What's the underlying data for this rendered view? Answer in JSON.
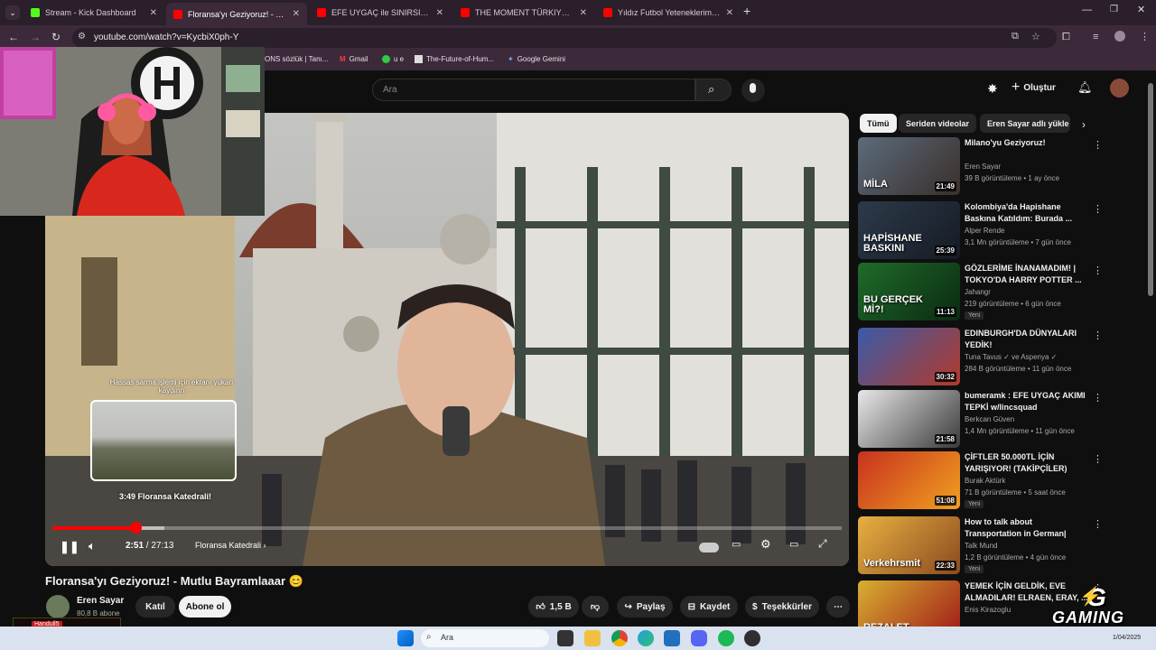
{
  "browser": {
    "tabs": [
      {
        "label": "Stream - Kick Dashboard",
        "active": false,
        "icon_color": "#53fc18"
      },
      {
        "label": "Floransa'yı Geziyoruz! - Mu",
        "active": true,
        "icon_color": "#ff0000"
      },
      {
        "label": "EFE UYGAÇ ile SINIRSIZ YEMEK",
        "active": false,
        "icon_color": "#ff0000"
      },
      {
        "label": "THE MOMENT TÜRKIYE QUALIF",
        "active": false,
        "icon_color": "#ff0000"
      },
      {
        "label": "Yıldız Futbol Yeteneklerimi Puan",
        "active": false,
        "icon_color": "#ff0000"
      }
    ],
    "url": "youtube.com/watch?v=KycbiX0ph-Y",
    "bookmarks": [
      {
        "label": "ONS sözlük | Tanı...",
        "icon": "dictionary-icon"
      },
      {
        "label": "Gmail",
        "icon": "gmail-icon"
      },
      {
        "label": "u e",
        "icon": "green-dot-icon"
      },
      {
        "label": "The-Future-of-Hum...",
        "icon": "page-icon"
      },
      {
        "label": "Google Gemini",
        "icon": "gemini-icon"
      }
    ]
  },
  "youtube": {
    "search_placeholder": "Ara",
    "create_label": "Oluştur",
    "video": {
      "title": "Floransa'yı Geziyoruz! - Mutlu Bayramlaaar 😊",
      "time_current": "2:51",
      "time_total": "27:13",
      "chapter": "Floransa Katedrali",
      "progress_fraction": 0.105,
      "preview_time": "3:49",
      "preview_chapter": "Floransa Katedrali!",
      "scroll_hint": "Hassas sarma işlemi için ekranı yukarı kaydırın"
    },
    "channel": {
      "name": "Eren Sayar",
      "subscribers": "80,8 B abone",
      "join_label": "Katıl",
      "subscribe_label": "Abone ol"
    },
    "actions": {
      "likes": "1,5 B",
      "share": "Paylaş",
      "save": "Kaydet",
      "thanks": "Teşekkürler"
    },
    "chips": [
      "Tümü",
      "Seriden videolar",
      "Eren Sayar adlı yükle"
    ],
    "recommendations": [
      {
        "title": "Milano'yu Geziyoruz!",
        "channel": "Eren Sayar",
        "views": "39 B görüntüleme • 1 ay önce",
        "duration": "21:49",
        "badge": "",
        "thumb_text": "MİLA",
        "colors": [
          "#5b6b7c",
          "#3a2f2a"
        ]
      },
      {
        "title": "Kolombiya'da Hapishane Baskına Katıldım: Burada ...",
        "channel": "Alper Rende",
        "views": "3,1 Mn görüntüleme • 7 gün önce",
        "duration": "25:39",
        "badge": "",
        "thumb_text": "HAPİSHANE BASKINI",
        "colors": [
          "#2d3a4a",
          "#151b24"
        ]
      },
      {
        "title": "GÖZLERİME İNANAMADIM! | TOKYO'DA HARRY POTTER ...",
        "channel": "Jahangr",
        "views": "219 görüntüleme • 6 gün önce",
        "duration": "11:13",
        "badge": "Yeni",
        "thumb_text": "BU GERÇEK Mİ?!",
        "colors": [
          "#1f6b2a",
          "#0b2a12"
        ]
      },
      {
        "title": "EDINBURGH'DA DÜNYALARI YEDİK!",
        "channel": "Tuna Tavus ✓ ve Aspenya ✓",
        "views": "284 B görüntüleme • 11 gün önce",
        "duration": "30:32",
        "badge": "",
        "thumb_text": "",
        "colors": [
          "#3a5aa8",
          "#b23a2a"
        ]
      },
      {
        "title": "bumeramk : EFE UYGAÇ AKIMI TEPKİ w/lincsquad",
        "channel": "Berkcan Güven",
        "views": "1,4 Mn görüntüleme • 11 gün önce",
        "duration": "21:58",
        "badge": "",
        "thumb_text": "",
        "colors": [
          "#e8e8e8",
          "#3a3a3a"
        ]
      },
      {
        "title": "ÇİFTLER 50.000TL İÇİN YARIŞIYOR! (TAKİPÇİLER)",
        "channel": "Burak Aktürk",
        "views": "71 B görüntüleme • 5 saat önce",
        "duration": "51:08",
        "badge": "Yeni",
        "thumb_text": "",
        "colors": [
          "#c8321e",
          "#f0a020"
        ]
      },
      {
        "title": "How to talk about Transportation in German| Eas...",
        "channel": "Talk Mund",
        "views": "1,2 B görüntüleme • 4 gün önce",
        "duration": "22:33",
        "badge": "Yeni",
        "thumb_text": "Verkehrsmit",
        "colors": [
          "#e8b040",
          "#8a4a20"
        ]
      },
      {
        "title": "YEMEK İÇİN GELDİK, EVE ALMADILAR! ELRAEN, ERAY, ...",
        "channel": "Enis Kirazoglu",
        "views": "",
        "duration": "",
        "badge": "",
        "thumb_text": "REZALET",
        "colors": [
          "#d8b030",
          "#a01818"
        ]
      }
    ]
  },
  "overlays": {
    "watermark": "GAMING",
    "streamer_tag": "Handull5"
  },
  "taskbar": {
    "search_label": "Ara",
    "date": "1/04/2025"
  }
}
